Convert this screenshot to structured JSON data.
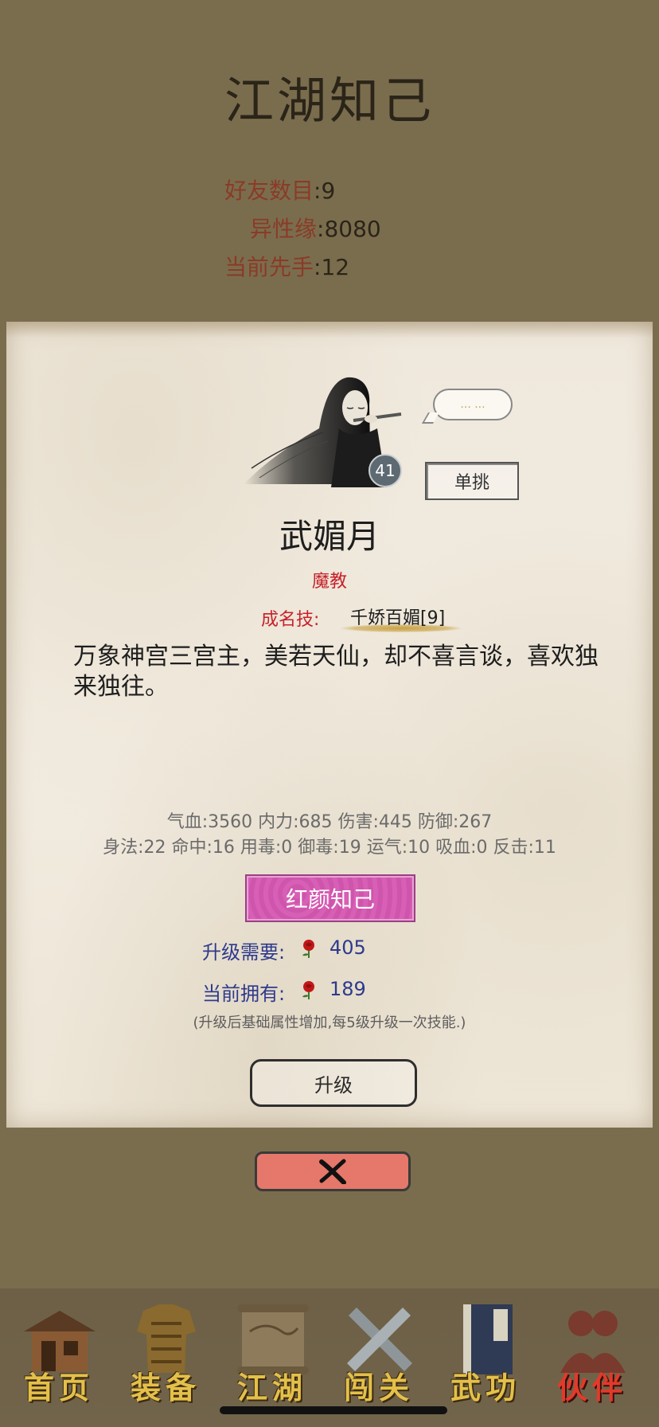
{
  "header": {
    "title": "江湖知己",
    "stats": [
      {
        "label": "好友数目",
        "value": "9"
      },
      {
        "label": "异性缘",
        "value": "8080"
      },
      {
        "label": "当前先手",
        "value": "12"
      }
    ]
  },
  "card": {
    "bubble_text": "... ...",
    "level": "41",
    "duel_label": "单挑",
    "name": "武媚月",
    "faction": "魔教",
    "skill_label": "成名技:",
    "skill_value": "千娇百媚[9]",
    "description": "万象神宫三宫主，美若天仙，却不喜言谈，喜欢独来独往。",
    "stats_line1": "气血:3560  内力:685  伤害:445  防御:267",
    "stats_line2": "身法:22  命中:16  用毒:0  御毒:19  运气:10  吸血:0  反击:11",
    "bond_label": "红颜知己",
    "upgrade_need_label": "升级需要:",
    "upgrade_need_value": "405",
    "current_have_label": "当前拥有:",
    "current_have_value": "189",
    "note": "(升级后基础属性增加,每5级升级一次技能.)",
    "upgrade_label": "升级",
    "close_icon": "close-x-icon",
    "rose_icon": "rose-icon"
  },
  "nav": {
    "items": [
      {
        "label": "首页",
        "icon": "house-icon"
      },
      {
        "label": "装备",
        "icon": "armor-icon"
      },
      {
        "label": "江湖",
        "icon": "scroll-map-icon"
      },
      {
        "label": "闯关",
        "icon": "swords-icon"
      },
      {
        "label": "武功",
        "icon": "book-icon"
      },
      {
        "label": "伙伴",
        "icon": "partners-icon"
      }
    ],
    "active_index": 5
  },
  "colors": {
    "background": "#7a6d4e",
    "accent_red": "#c7212a",
    "accent_blue": "#2d3a8c",
    "bond_pink": "#d85fb6",
    "close_salmon": "#e5786a",
    "nav_gold": "#e4c04a"
  }
}
